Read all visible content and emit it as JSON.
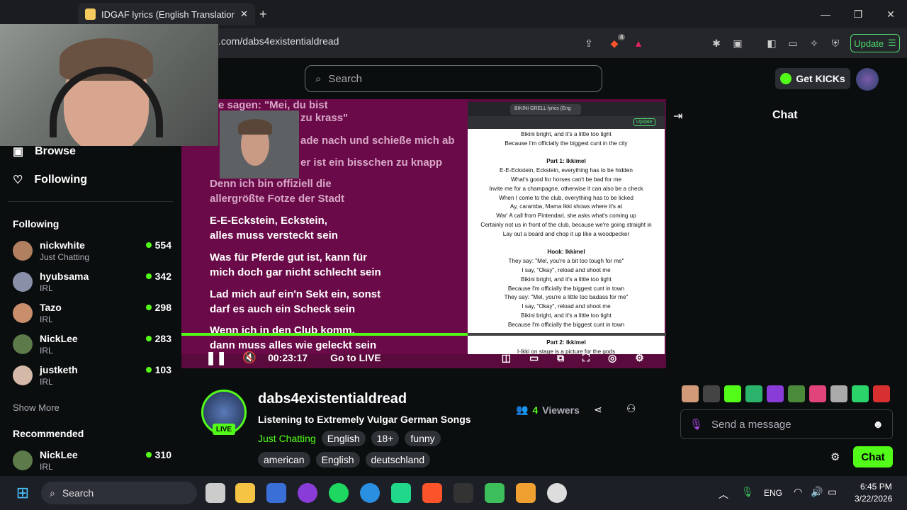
{
  "browser": {
    "tab_title": "IDGAF lyrics (English Translation) – Ik",
    "url": ".com/dabs4existentialdread",
    "update_label": "Update",
    "brave_badge": "4"
  },
  "header": {
    "search_placeholder": "Search",
    "get_kicks": "Get KICKs"
  },
  "sidebar": {
    "nav": [
      {
        "label": "Browse"
      },
      {
        "label": "Following"
      }
    ],
    "following_title": "Following",
    "following": [
      {
        "name": "nickwhite",
        "category": "Just Chatting",
        "viewers": "554"
      },
      {
        "name": "hyubsama",
        "category": "IRL",
        "viewers": "342"
      },
      {
        "name": "Tazo",
        "category": "IRL",
        "viewers": "298"
      },
      {
        "name": "NickLee",
        "category": "IRL",
        "viewers": "283"
      },
      {
        "name": "justketh",
        "category": "IRL",
        "viewers": "103"
      }
    ],
    "show_more": "Show More",
    "recommended_title": "Recommended",
    "recommended": [
      {
        "name": "NickLee",
        "category": "IRL",
        "viewers": "310"
      }
    ]
  },
  "video": {
    "lyrics_dim": [
      "e sagen: \"Mei, du bist",
      "zu krass\"",
      "ade nach und schieße mich ab",
      "er ist ein bisschen zu knapp",
      "Denn ich bin offiziell die",
      "allergrößte Fotze der Stadt"
    ],
    "lyrics_bright": [
      "E-E-Eckstein, Eckstein,",
      "alles muss versteckt sein",
      "Was für Pferde gut ist, kann für",
      "mich doch gar nicht schlecht sein",
      "Lad mich auf ein'n Sekt ein, sonst",
      "darf es auch ein Scheck sein",
      "Wenn ich in den Club komm,",
      "dann muss alles wie geleckt sein"
    ],
    "inner_tab": "BIKINI GRELL lyrics (Eng",
    "inner_update": "Update",
    "translation": [
      {
        "t": "Bikini bright, and it's a little too tight",
        "b": false
      },
      {
        "t": "Because I'm officially the biggest cunt in the city",
        "b": false
      },
      {
        "t": "",
        "b": false
      },
      {
        "t": "Part 1: Ikkimel",
        "b": true
      },
      {
        "t": "E-E-Eckstein, Eckstein, everything has to be hidden",
        "b": false
      },
      {
        "t": "What's good for horses can't be bad for me",
        "b": false
      },
      {
        "t": "Invite me for a champagne, otherwise it can also be a check",
        "b": false
      },
      {
        "t": "When I come to the club, everything has to be licked",
        "b": false
      },
      {
        "t": "Ay, caramba, Mama Ikki shows where it's at",
        "b": false
      },
      {
        "t": "War' A call from Pintendari, she asks what's coming up",
        "b": false
      },
      {
        "t": "Certainly not us in front of the club, because we're going straight in",
        "b": false
      },
      {
        "t": "Lay out a board and chop it up like a woodpecker",
        "b": false
      },
      {
        "t": "",
        "b": false
      },
      {
        "t": "Hook: Ikkimel",
        "b": true
      },
      {
        "t": "They say: \"Mel, you're a bit too tough for me\"",
        "b": false
      },
      {
        "t": "I say, \"Okay\", reload and shoot me",
        "b": false
      },
      {
        "t": "Bikini bright, and it's a little too tight",
        "b": false
      },
      {
        "t": "Because I'm officially the biggest cunt in town",
        "b": false
      },
      {
        "t": "They say: \"Mel, you're a little too badass for me\"",
        "b": false
      },
      {
        "t": "I say, \"Okay\", reload and shoot me",
        "b": false
      },
      {
        "t": "Bikini bright, and it's a little too tight",
        "b": false
      },
      {
        "t": "Because I'm officially the biggest cunt in town",
        "b": false
      },
      {
        "t": "",
        "b": false
      },
      {
        "t": "Part 2: Ikkimel",
        "b": true
      },
      {
        "t": "I-Ikki on stage is a picture for the gods",
        "b": false
      }
    ],
    "time": "00:23:17",
    "go_live": "Go to LIVE",
    "progress": 0.59
  },
  "stream": {
    "channel": "dabs4existentialdread",
    "title": "Listening to Extremely Vulgar German Songs",
    "category": "Just Chatting",
    "live": "LIVE",
    "viewers_count": "4",
    "viewers_label": "Viewers",
    "tags_row1": [
      "English",
      "18+",
      "funny"
    ],
    "tags_row2": [
      "american",
      "English",
      "deutschland"
    ]
  },
  "chat": {
    "title": "Chat",
    "placeholder": "Send a message",
    "send": "Chat"
  },
  "taskbar": {
    "search": "Search",
    "lang": "ENG",
    "time": "6:45 PM",
    "date": "3/22/2026"
  }
}
